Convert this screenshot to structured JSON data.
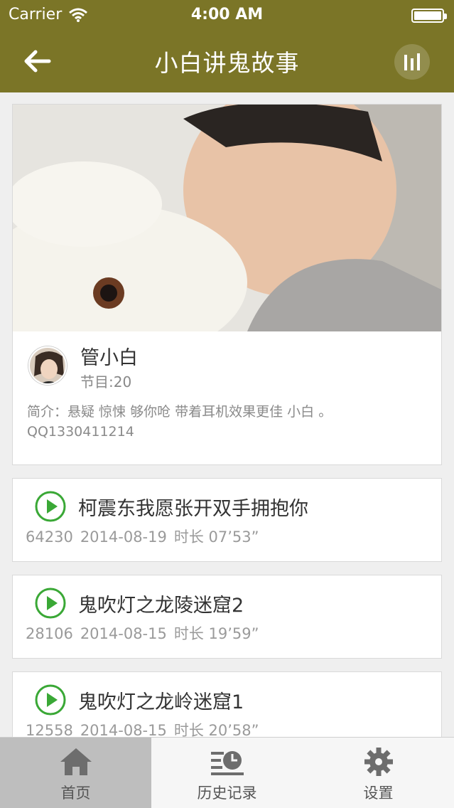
{
  "status_bar": {
    "carrier": "Carrier",
    "time": "4:00 AM"
  },
  "nav": {
    "title": "小白讲鬼故事",
    "back_icon": "back-arrow-icon",
    "player_icon": "equalizer-icon"
  },
  "profile": {
    "name": "管小白",
    "episodes": "节目:20",
    "intro": "简介：悬疑  惊悚  够你呛  带着耳机效果更佳  小白  。 QQ1330411214"
  },
  "episodes": [
    {
      "title": "柯震东我愿张开双手拥抱你",
      "plays": "64230",
      "date": "2014-08-19",
      "duration": "时长 07’53”"
    },
    {
      "title": "鬼吹灯之龙陵迷窟2",
      "plays": "28106",
      "date": "2014-08-15",
      "duration": "时长 19’59”"
    },
    {
      "title": "鬼吹灯之龙岭迷窟1",
      "plays": "12558",
      "date": "2014-08-15",
      "duration": "时长 20’58”"
    }
  ],
  "tabs": [
    {
      "label": "首页",
      "icon": "home-icon",
      "active": true
    },
    {
      "label": "历史记录",
      "icon": "history-icon",
      "active": false
    },
    {
      "label": "设置",
      "icon": "gear-icon",
      "active": false
    }
  ],
  "colors": {
    "nav_bg": "#7b7527",
    "play_green": "#3aa836",
    "active_tab": "#bebebe"
  }
}
